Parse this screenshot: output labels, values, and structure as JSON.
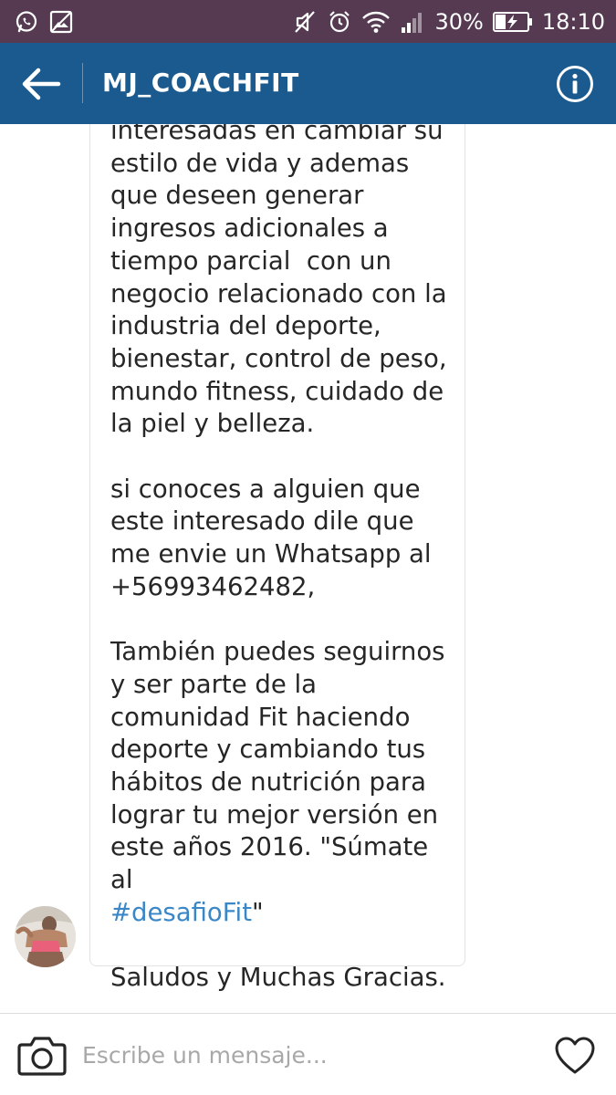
{
  "status_bar": {
    "battery_percent": "30%",
    "time": "18:10",
    "left_icons": [
      "whatsapp-icon",
      "image-icon"
    ],
    "right_icons": [
      "mute-icon",
      "alarm-icon",
      "wifi-icon",
      "signal-icon",
      "battery-charging-icon"
    ]
  },
  "header": {
    "title": "MJ_COACHFIT",
    "back_icon": "arrow-left-icon",
    "info_icon": "info-icon"
  },
  "message": {
    "line_01": "interesadas en cambiar su",
    "line_02": "estilo de vida y ademas",
    "line_03": "que deseen generar",
    "line_04": "ingresos adicionales a",
    "line_05": "tiempo parcial  con un",
    "line_06": "negocio relacionado con la",
    "line_07": "industria del deporte,",
    "line_08": "bienestar, control de peso,",
    "line_09": "mundo fitness, cuidado de",
    "line_10": "la piel y belleza.",
    "line_11": "si conoces a alguien que",
    "line_12": "este interesado dile que",
    "line_13": "me envie un Whatsapp al",
    "line_14": "+56993462482,",
    "line_15": "También puedes seguirnos",
    "line_16": "y ser parte de la",
    "line_17": "comunidad Fit haciendo",
    "line_18": "deporte y cambiando tus",
    "line_19": "hábitos de nutrición para",
    "line_20": "lograr tu mejor versión en",
    "line_21": "este años 2016. \"Súmate al",
    "hashtag": "#desafioFit",
    "hashtag_suffix": "\"",
    "line_23": "Saludos y Muchas Gracias."
  },
  "composer": {
    "placeholder": "Escribe un mensaje...",
    "camera_icon": "camera-icon",
    "heart_icon": "heart-icon"
  },
  "colors": {
    "status_bar": "#553a52",
    "app_bar": "#1b5a8e",
    "hashtag": "#3a87c8",
    "text": "#262626"
  }
}
